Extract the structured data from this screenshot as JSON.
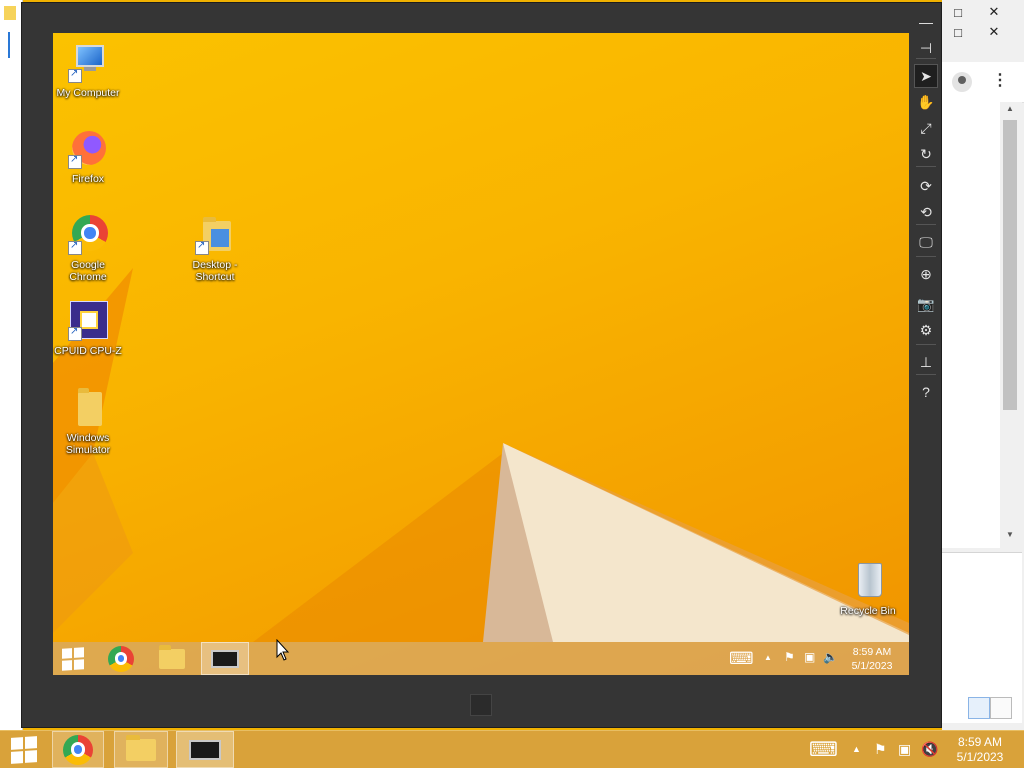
{
  "host": {
    "window_controls": {
      "restore_icon": "□",
      "close_icon": "✕",
      "restore2_icon": "□",
      "close2_icon": "✕"
    },
    "side_panel": {
      "kebab_icon": "⋮",
      "scroll_up": "▲",
      "scroll_down": "▼"
    },
    "taskbar": {
      "items": [
        "start-button",
        "chrome",
        "file-explorer",
        "virtual-machine"
      ],
      "tray": {
        "keyboard_icon": "⌨",
        "chevron_icon": "▲",
        "time": "8:59 AM",
        "date": "5/1/2023"
      }
    }
  },
  "vm": {
    "toolbar": [
      {
        "name": "minimize-icon",
        "glyph": "—"
      },
      {
        "name": "pin-icon",
        "glyph": "⊣"
      },
      {
        "name": "select-pointer-icon",
        "glyph": "➤",
        "active": true
      },
      {
        "name": "hand-tool-icon",
        "glyph": "✋"
      },
      {
        "name": "pinch-zoom-icon",
        "glyph": "⤢"
      },
      {
        "name": "rotate-gesture-icon",
        "glyph": "↻"
      },
      {
        "name": "rotate-clockwise-icon",
        "glyph": "⟳"
      },
      {
        "name": "rotate-counterclockwise-icon",
        "glyph": "⟲"
      },
      {
        "name": "change-resolution-icon",
        "glyph": "🖵"
      },
      {
        "name": "set-location-icon",
        "glyph": "⊕"
      },
      {
        "name": "screenshot-icon",
        "glyph": "📷"
      },
      {
        "name": "settings-icon",
        "glyph": "⚙"
      },
      {
        "name": "network-icon",
        "glyph": "⊥"
      },
      {
        "name": "help-icon",
        "glyph": "?"
      }
    ],
    "desktop_icons": {
      "my_computer": "My Computer",
      "firefox": "Firefox",
      "chrome": "Google Chrome",
      "desktop_shortcut": "Desktop - Shortcut",
      "cpuz": "CPUID CPU-Z",
      "simulator": "Windows Simulator",
      "recycle_bin": "Recycle Bin"
    },
    "taskbar": {
      "time": "8:59 AM",
      "date": "5/1/2023",
      "keyboard_icon": "⌨",
      "chevron_icon": "▲",
      "flag_icon": "⚑",
      "network_icon": "▣",
      "volume_icon": "🔈"
    }
  },
  "colors": {
    "wallpaper_main": "#f9b400",
    "wallpaper_light": "#f3e3c8",
    "frame": "#353535"
  }
}
